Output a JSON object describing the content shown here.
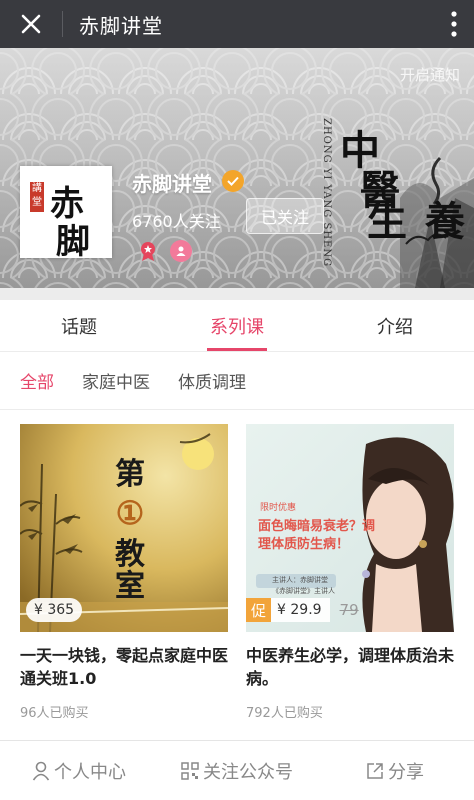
{
  "topbar": {
    "title": "赤脚讲堂"
  },
  "banner": {
    "notify_label": "开启通知",
    "art_pinyin": "ZHONG YI YANG SHENG",
    "art_calligraphy": [
      "中",
      "醫",
      "養生"
    ]
  },
  "account": {
    "logo_chars": [
      "赤",
      "脚"
    ],
    "logo_stamp": "講堂",
    "name": "赤脚讲堂",
    "followers": "6760人关注",
    "follow_button": "已关注"
  },
  "tabs": [
    {
      "label": "话题",
      "active": false
    },
    {
      "label": "系列课",
      "active": true
    },
    {
      "label": "介绍",
      "active": false
    }
  ],
  "filters": [
    {
      "label": "全部",
      "active": true
    },
    {
      "label": "家庭中医",
      "active": false
    },
    {
      "label": "体质调理",
      "active": false
    }
  ],
  "courses": [
    {
      "thumb_text": [
        "第",
        "①",
        "教",
        "室"
      ],
      "price": "¥ 365",
      "title": "一天一块钱，零起点家庭中医通关班1.0",
      "sold": "96人已购买"
    },
    {
      "promo_badge": "促",
      "price": "¥ 29.9",
      "orig_price": "79",
      "thumb_caption_top": "限时优惠",
      "thumb_caption_main": "面色晦暗易衰老？调理体质防生病！",
      "thumb_caption_small": "主讲人：赤脚讲堂",
      "thumb_caption_small2": "《赤脚讲堂》主讲人",
      "title": "中医养生必学，调理体质治未病。",
      "sold": "792人已购买"
    }
  ],
  "bottombar": {
    "personal": "个人中心",
    "follow_account": "关注公众号",
    "share": "分享"
  },
  "colors": {
    "accent": "#e6466a",
    "topbar": "#393a3f",
    "promo": "#f2a43a",
    "verify": "#f3a52a"
  }
}
